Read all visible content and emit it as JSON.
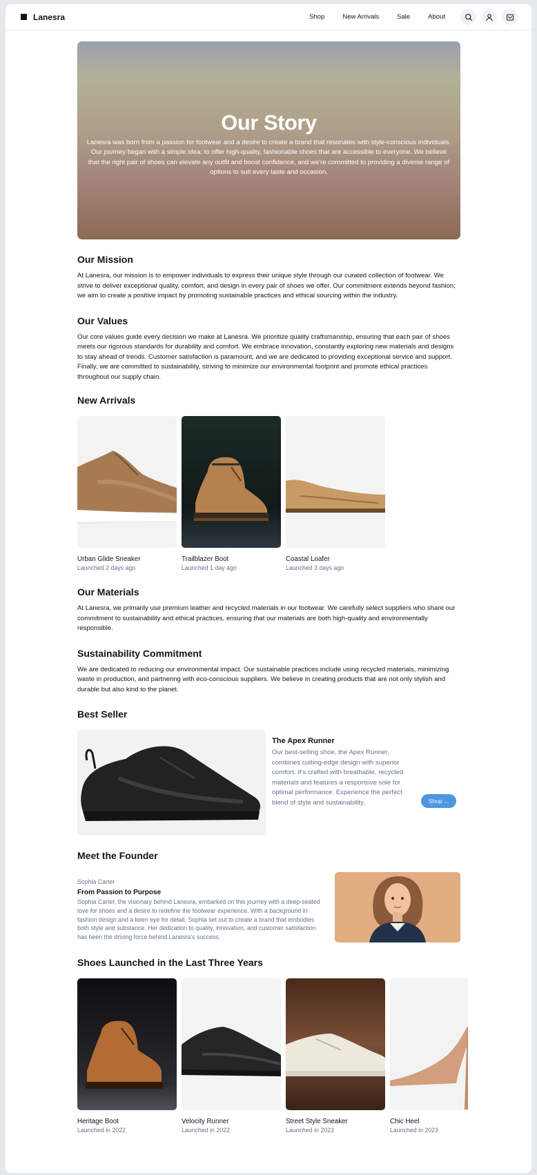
{
  "header": {
    "brand": "Lanesra",
    "nav": [
      "Shop",
      "New Arrivals",
      "Sale",
      "About"
    ],
    "icons": [
      "search-icon",
      "user-icon",
      "cart-icon"
    ]
  },
  "hero": {
    "title": "Our Story",
    "text": "Lanesra was born from a passion for footwear and a desire to create a brand that resonates with style-conscious individuals. Our journey began with a simple idea: to offer high-quality, fashionable shoes that are accessible to everyone. We believe that the right pair of shoes can elevate any outfit and boost confidence, and we're committed to providing a diverse range of options to suit every taste and occasion."
  },
  "mission": {
    "title": "Our Mission",
    "text": "At Lanesra, our mission is to empower individuals to express their unique style through our curated collection of footwear. We strive to deliver exceptional quality, comfort, and design in every pair of shoes we offer. Our commitment extends beyond fashion; we aim to create a positive impact by promoting sustainable practices and ethical sourcing within the industry."
  },
  "values": {
    "title": "Our Values",
    "text": "Our core values guide every decision we make at Lanesra. We prioritize quality craftsmanship, ensuring that each pair of shoes meets our rigorous standards for durability and comfort. We embrace innovation, constantly exploring new materials and designs to stay ahead of trends. Customer satisfaction is paramount, and we are dedicated to providing exceptional service and support. Finally, we are committed to sustainability, striving to minimize our environmental footprint and promote ethical practices throughout our supply chain."
  },
  "new_arrivals": {
    "title": "New Arrivals",
    "items": [
      {
        "name": "Urban Glide Sneaker",
        "sub": "Launched 2 days ago"
      },
      {
        "name": "Trailblazer Boot",
        "sub": "Launched 1 day ago"
      },
      {
        "name": "Coastal Loafer",
        "sub": "Launched 3 days ago"
      }
    ]
  },
  "materials": {
    "title": "Our Materials",
    "text": "At Lanesra, we primarily use premium leather and recycled materials in our footwear. We carefully select suppliers who share our commitment to sustainability and ethical practices, ensuring that our materials are both high-quality and environmentally responsible."
  },
  "sustainability": {
    "title": "Sustainability Commitment",
    "text": "We are dedicated to reducing our environmental impact. Our sustainable practices include using recycled materials, minimizing waste in production, and partnering with eco-conscious suppliers. We believe in creating products that are not only stylish and durable but also kind to the planet."
  },
  "best_seller": {
    "title": "Best Seller",
    "product": "The Apex Runner",
    "text": "Our best-selling shoe, the Apex Runner, combines cutting-edge design with superior comfort. It's crafted with breathable, recycled materials and features a responsive sole for optimal performance. Experience the perfect blend of style and sustainability.",
    "button": "Shop ..."
  },
  "founder": {
    "title": "Meet the Founder",
    "name": "Sophia Carter",
    "subtitle": "From Passion to Purpose",
    "text": "Sophia Carter, the visionary behind Lanesra, embarked on this journey with a deep-seated love for shoes and a desire to redefine the footwear experience. With a background in fashion design and a keen eye for detail, Sophia set out to create a brand that embodies both style and substance. Her dedication to quality, innovation, and customer satisfaction has been the driving force behind Lanesra's success."
  },
  "launched": {
    "title": "Shoes Launched in the Last Three Years",
    "items": [
      {
        "name": "Heritage Boot",
        "sub": "Launched in 2022"
      },
      {
        "name": "Velocity Runner",
        "sub": "Launched in 2022"
      },
      {
        "name": "Street Style Sneaker",
        "sub": "Launched in 2023"
      },
      {
        "name": "Chic Heel",
        "sub": "Launched in 2023"
      }
    ]
  },
  "colors": {
    "accent": "#4d97e0",
    "muted_text": "#677189",
    "primary_text": "#121417"
  }
}
